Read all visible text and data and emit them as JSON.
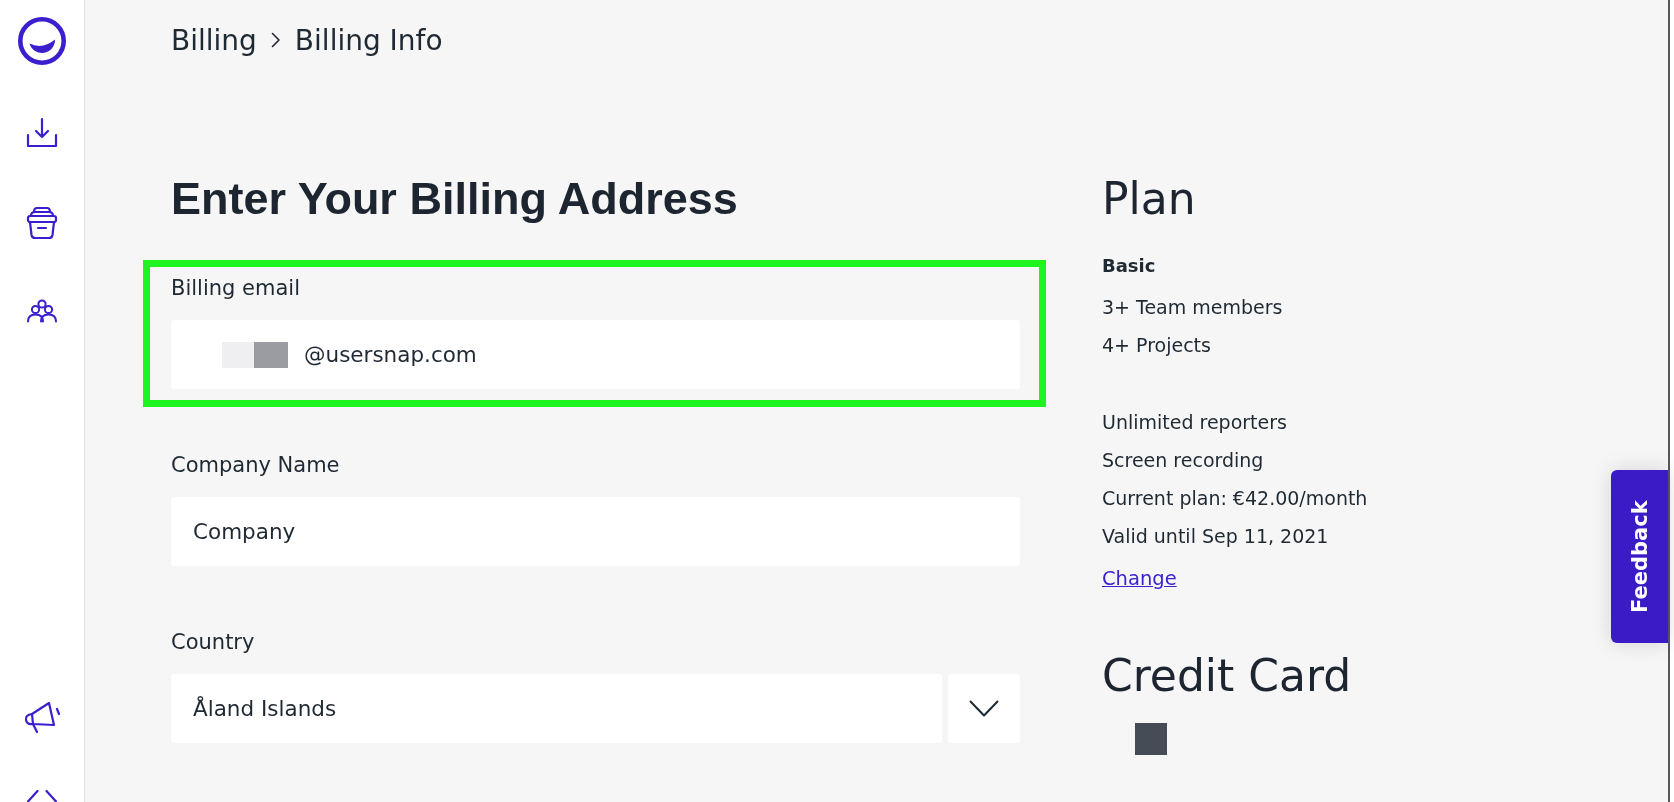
{
  "breadcrumb": [
    "Billing",
    "Billing Info"
  ],
  "form": {
    "title": "Enter Your Billing Address",
    "fields": [
      {
        "kind": "text",
        "label": "Billing email",
        "value": "@usersnap.com",
        "redacted": true,
        "highlighted": true
      },
      {
        "kind": "text",
        "label": "Company Name",
        "value": "Company",
        "redacted": false,
        "highlighted": false
      },
      {
        "kind": "select",
        "label": "Country",
        "value": "Åland Islands",
        "redacted": false,
        "highlighted": false
      }
    ]
  },
  "plan": {
    "title": "Plan",
    "name": "Basic",
    "feature_groups": [
      {
        "items": [
          "3+ Team members",
          "4+ Projects"
        ]
      },
      {
        "items": [
          "Unlimited reporters",
          "Screen recording",
          "Current plan: €42.00/month",
          "Valid until Sep 11, 2021"
        ]
      }
    ],
    "link": "Change"
  },
  "credit_card": {
    "title": "Credit Card",
    "redacted": true
  },
  "feedback_tab": {
    "label": "Feedback"
  }
}
